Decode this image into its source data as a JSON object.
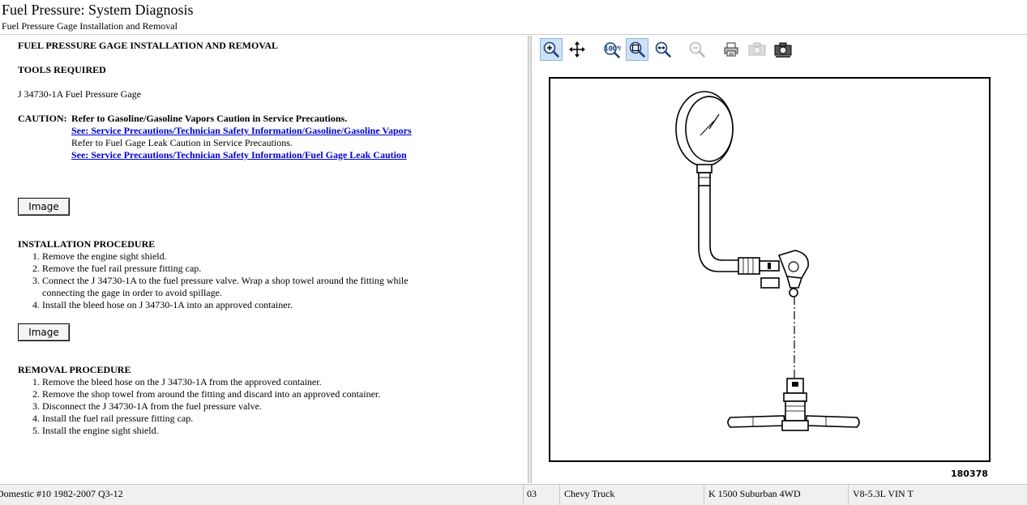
{
  "header": {
    "title": "Fuel Pressure:  System Diagnosis",
    "subtitle": "Fuel Pressure Gage Installation and Removal"
  },
  "doc": {
    "main_heading": "FUEL PRESSURE GAGE INSTALLATION AND REMOVAL",
    "tools_heading": "TOOLS REQUIRED",
    "tool_item": "J 34730-1A Fuel Pressure Gage",
    "caution_label": "CAUTION:",
    "caution_line1": "Refer to Gasoline/Gasoline Vapors Caution in Service Precautions.",
    "caution_link1": "See: Service Precautions/Technician Safety Information/Gasoline/Gasoline Vapors",
    "caution_line2": "Refer to Fuel Gage Leak Caution in Service Precautions.",
    "caution_link2": "See: Service Precautions/Technician Safety Information/Fuel Gage Leak Caution",
    "image_button_label": "Image",
    "installation_heading": "INSTALLATION PROCEDURE",
    "installation_steps": [
      "Remove the engine sight shield.",
      "Remove the fuel rail pressure fitting cap.",
      "Connect the J 34730-1A to the fuel pressure valve. Wrap a shop towel around the fitting while connecting the gage in order to avoid spillage.",
      "Install the bleed hose on J 34730-1A into an approved container."
    ],
    "removal_heading": "REMOVAL PROCEDURE",
    "removal_steps": [
      "Remove the bleed hose on the J 34730-1A from the approved container.",
      "Remove the shop towel from around the fitting and discard into an approved container.",
      "Disconnect the J 34730-1A from the fuel pressure valve.",
      "Install the fuel rail pressure fitting cap.",
      "Install the engine sight shield."
    ]
  },
  "toolbar": {
    "buttons": [
      {
        "icon": "zoom-in-icon",
        "state": "active"
      },
      {
        "icon": "pan-icon",
        "state": "normal"
      },
      {
        "icon": "zoom-100-icon",
        "state": "normal",
        "label": "100%"
      },
      {
        "icon": "zoom-fit-icon",
        "state": "active"
      },
      {
        "icon": "zoom-width-icon",
        "state": "normal"
      },
      {
        "icon": "zoom-out-icon",
        "state": "disabled"
      },
      {
        "icon": "print-icon",
        "state": "normal"
      },
      {
        "icon": "camera-icon",
        "state": "disabled"
      },
      {
        "icon": "camera-save-icon",
        "state": "normal"
      }
    ]
  },
  "figure": {
    "number": "180378"
  },
  "status": {
    "product": "Domestic #10 1982-2007 Q3-12",
    "year": "03",
    "make": "Chevy Truck",
    "model": "K 1500 Suburban 4WD",
    "engine": "V8-5.3L VIN T"
  },
  "colors": {
    "link": "#0000cc",
    "toolbar_active": "#cde1f6"
  }
}
